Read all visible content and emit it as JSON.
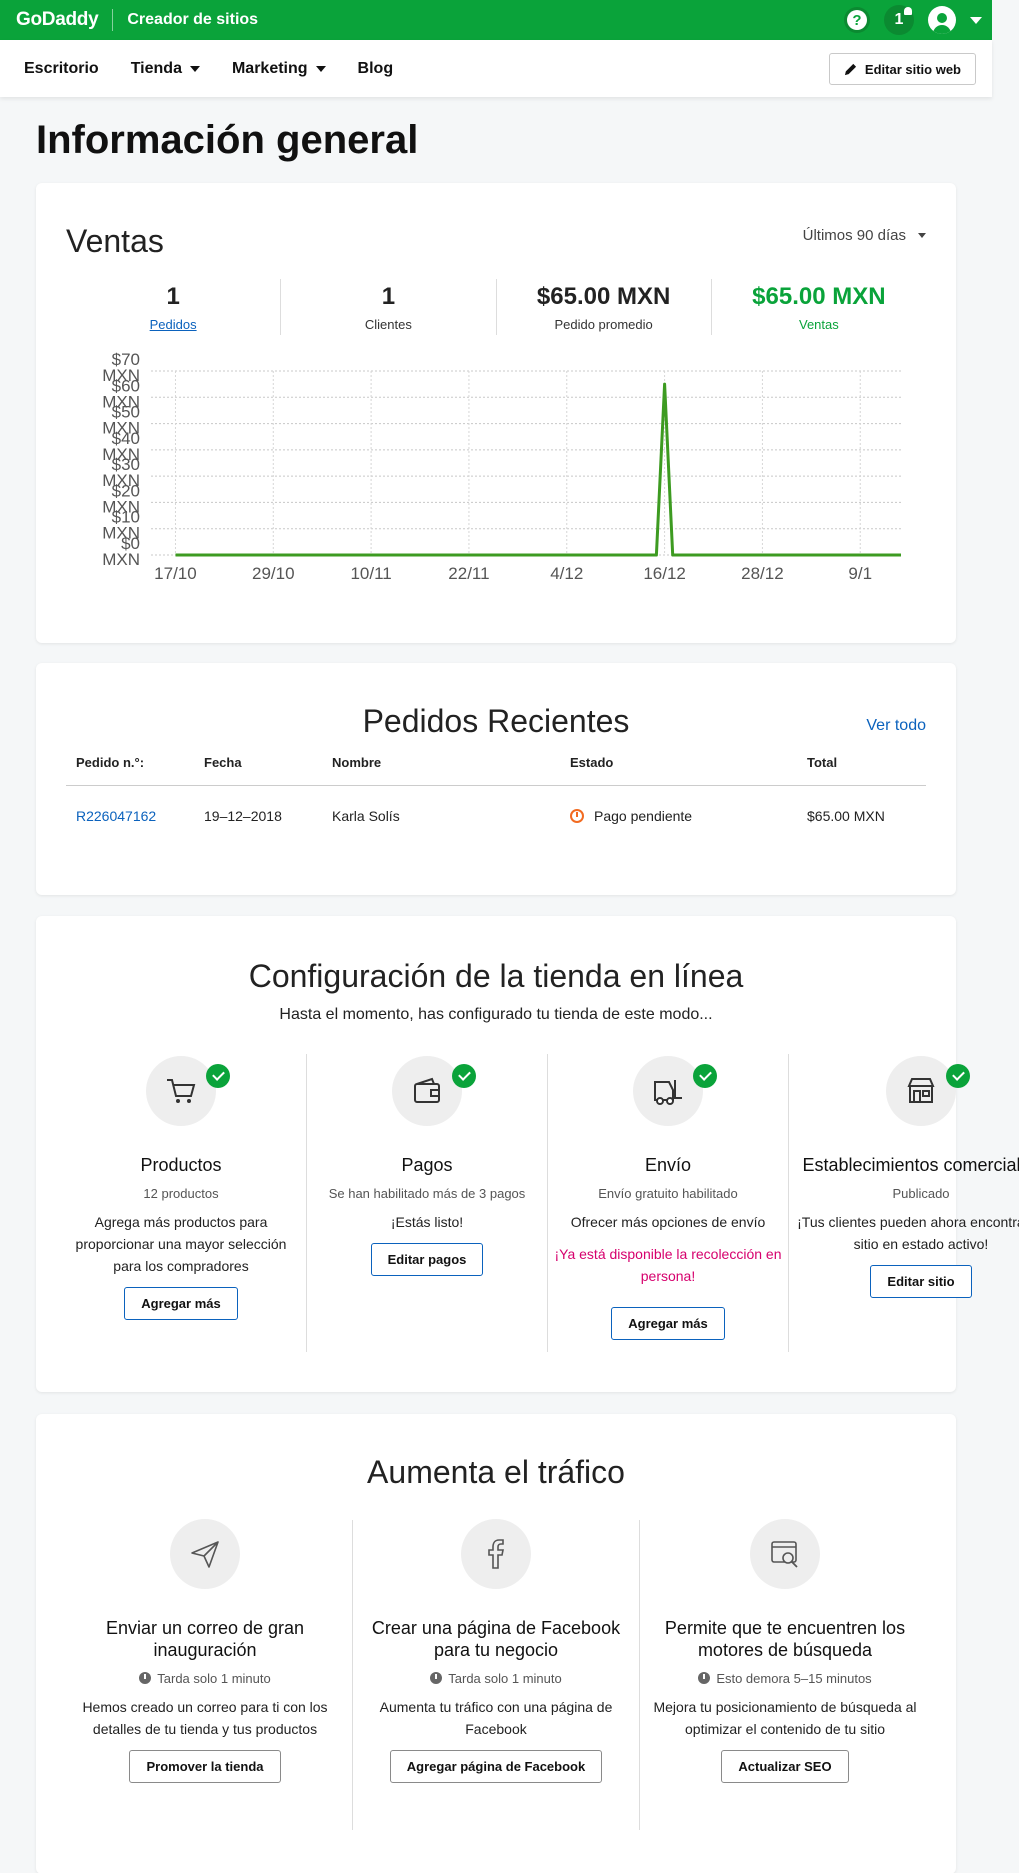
{
  "topbar": {
    "brand": "GoDaddy",
    "product": "Creador de sitios",
    "help_icon": "question-icon",
    "notification_count": "1",
    "user_icon": "user-icon"
  },
  "nav": {
    "items": [
      {
        "label": "Escritorio",
        "dropdown": false
      },
      {
        "label": "Tienda",
        "dropdown": true
      },
      {
        "label": "Marketing",
        "dropdown": true
      },
      {
        "label": "Blog",
        "dropdown": false
      }
    ],
    "edit_button": "Editar sitio web"
  },
  "page_title": "Información general",
  "sales": {
    "title": "Ventas",
    "range": "Últimos 90 días",
    "stats": [
      {
        "value": "1",
        "label": "Pedidos",
        "link": true,
        "accent": false
      },
      {
        "value": "1",
        "label": "Clientes",
        "link": false,
        "accent": false
      },
      {
        "value": "$65.00 MXN",
        "label": "Pedido promedio",
        "link": false,
        "accent": false
      },
      {
        "value": "$65.00 MXN",
        "label": "Ventas",
        "link": false,
        "accent": true
      }
    ]
  },
  "chart_data": {
    "type": "line",
    "x_tick_labels": [
      "17/10",
      "29/10",
      "10/11",
      "22/11",
      "4/12",
      "16/12",
      "28/12",
      "9/1"
    ],
    "y_tick_labels": [
      "$0 MXN",
      "$10 MXN",
      "$20 MXN",
      "$30 MXN",
      "$40 MXN",
      "$50 MXN",
      "$60 MXN",
      "$70 MXN"
    ],
    "ylim": [
      0,
      70
    ],
    "series": [
      {
        "color": "#3d9b21",
        "points": [
          {
            "x": "17/10",
            "y": 0
          },
          {
            "x": "15/12",
            "y": 0
          },
          {
            "x": "16/12",
            "y": 65
          },
          {
            "x": "17/12",
            "y": 0
          },
          {
            "x": "14/1",
            "y": 0
          }
        ]
      }
    ],
    "x_range": [
      "14/10",
      "14/1"
    ],
    "grid": true
  },
  "recent_orders": {
    "title": "Pedidos Recientes",
    "see_all": "Ver todo",
    "columns": [
      "Pedido n.°:",
      "Fecha",
      "Nombre",
      "Estado",
      "Total"
    ],
    "rows": [
      {
        "id": "R226047162",
        "date": "19–12–2018",
        "name": "Karla Solís",
        "status": "Pago pendiente",
        "total": "$65.00 MXN"
      }
    ]
  },
  "store_setup": {
    "title": "Configuración de la tienda en línea",
    "subtitle": "Hasta el momento, has configurado tu tienda de este modo...",
    "items": [
      {
        "icon": "cart-icon",
        "title": "Productos",
        "meta": "12 productos",
        "desc": "Agrega más productos para proporcionar una mayor selección para los compradores",
        "promo": "",
        "button": "Agregar más"
      },
      {
        "icon": "wallet-icon",
        "title": "Pagos",
        "meta": "Se han habilitado más de 3 pagos",
        "desc": "¡Estás listo!",
        "promo": "",
        "button": "Editar pagos"
      },
      {
        "icon": "truck-icon",
        "title": "Envío",
        "meta": "Envío gratuito habilitado",
        "desc": "Ofrecer más opciones de envío",
        "promo": "¡Ya está disponible la recolección en persona!",
        "button": "Agregar más"
      },
      {
        "icon": "storefront-icon",
        "title": "Establecimientos comerciales",
        "meta": "Publicado",
        "desc": "¡Tus clientes pueden ahora encontrar tu sitio en estado activo!",
        "promo": "",
        "button": "Editar sitio"
      }
    ]
  },
  "traffic": {
    "title": "Aumenta el tráfico",
    "items": [
      {
        "icon": "paper-plane-icon",
        "title": "Enviar un correo de gran inauguración",
        "time": "Tarda solo 1 minuto",
        "desc": "Hemos creado un correo para ti con los detalles de tu tienda y tus productos",
        "button": "Promover la tienda"
      },
      {
        "icon": "facebook-icon",
        "title": "Crear una página de Facebook para tu negocio",
        "time": "Tarda solo 1 minuto",
        "desc": "Aumenta tu tráfico con una página de Facebook",
        "button": "Agregar página de Facebook"
      },
      {
        "icon": "seo-search-icon",
        "title": "Permite que te encuentren los motores de búsqueda",
        "time": "Esto demora 5–15 minutos",
        "desc": "Mejora tu posicionamiento de búsqueda al optimizar el contenido de tu sitio",
        "button": "Actualizar SEO"
      }
    ]
  }
}
